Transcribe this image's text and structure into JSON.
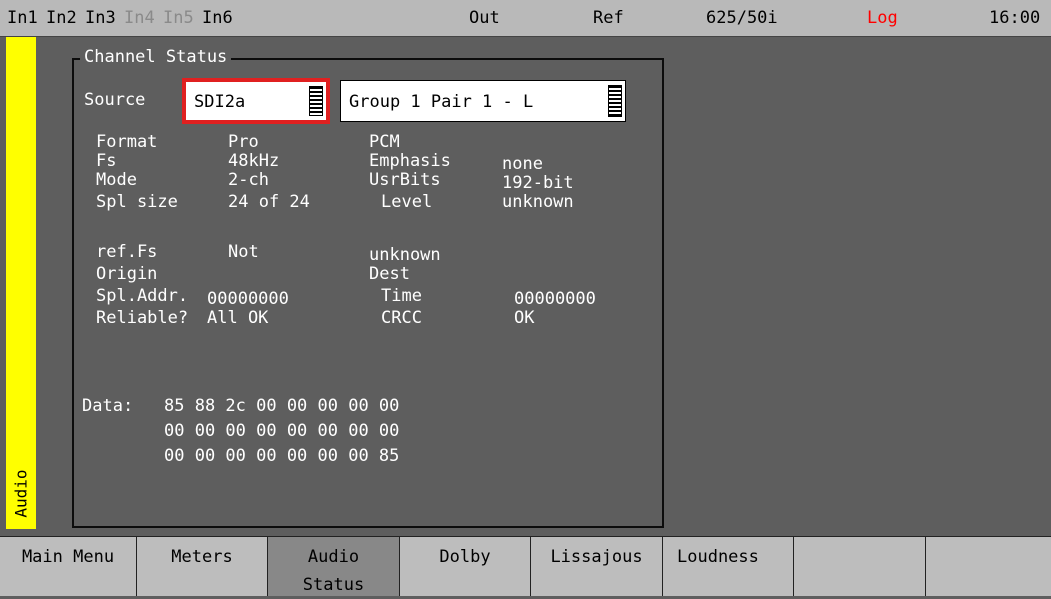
{
  "topbar": {
    "in1": "In1",
    "in2": "In2",
    "in3": "In3",
    "in4": "In4",
    "in5": "In5",
    "in6": "In6",
    "out": "Out",
    "ref": "Ref",
    "format": "625/50i",
    "log": "Log",
    "time": "16:00",
    "colors": {
      "log": "#ff0000",
      "disabled": "#8a8a8a"
    }
  },
  "sidetab": {
    "label": "Audio",
    "color": "#ffff00"
  },
  "panel": {
    "title": "Channel Status",
    "source_label": "Source",
    "source_value": "SDI2a",
    "group_value": "Group 1 Pair 1 - L",
    "rows1": {
      "format_label": "Format",
      "format_value": "Pro",
      "pcm": "PCM",
      "fs_label": "Fs",
      "fs_value": "48kHz",
      "emphasis_label": "Emphasis",
      "emphasis_value": "none",
      "mode_label": "Mode",
      "mode_value": "2-ch",
      "usrbits_label": "UsrBits",
      "usrbits_value": "192-bit",
      "splsize_label": "Spl size",
      "splsize_value": "24 of 24",
      "level_label": "Level",
      "level_value": "unknown"
    },
    "rows2": {
      "reffs_label": "ref.Fs",
      "reffs_value": "Not",
      "reffs_extra": "unknown",
      "origin_label": "Origin",
      "dest_label": "Dest",
      "spladdr_label": "Spl.Addr.",
      "spladdr_value": "00000000",
      "time_label": "Time",
      "time_value": "00000000",
      "reliable_label": "Reliable?",
      "reliable_value": "All OK",
      "crcc_label": "CRCC",
      "crcc_value": "OK"
    },
    "data": {
      "label": "Data:",
      "line1": "85 88 2c 00 00 00 00 00",
      "line2": "00 00 00 00 00 00 00 00",
      "line3": "00 00 00 00 00 00 00 85"
    }
  },
  "menu": {
    "main_menu": "Main Menu",
    "meters": "Meters",
    "audio_status_1": "Audio",
    "audio_status_2": "Status",
    "dolby": "Dolby",
    "lissajous": "Lissajous",
    "loudness": "Loudness"
  }
}
